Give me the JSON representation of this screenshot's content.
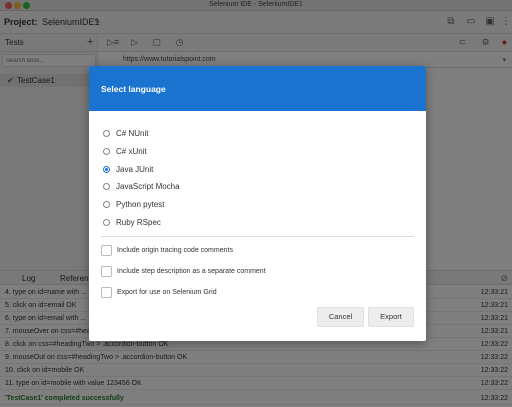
{
  "window": {
    "title": "Selenium IDE - SeleniumIDE1"
  },
  "project": {
    "label": "Project:",
    "name": "SeleniumIDE1"
  },
  "sidebar": {
    "header": "Tests",
    "search_placeholder": "Search tests...",
    "test_cases": [
      {
        "name": "TestCase1"
      }
    ]
  },
  "editor": {
    "url": "https://www.tutorialspoint.com"
  },
  "log": {
    "tabs": [
      "Log",
      "Reference"
    ],
    "lines": [
      {
        "text": "4.  type on id=name with ...",
        "time": "12:33:21"
      },
      {
        "text": "5.  click on id=email OK",
        "time": "12:33:21"
      },
      {
        "text": "6.  type on id=email with ...",
        "time": "12:33:21"
      },
      {
        "text": "7.  mouseOver on css=#heading...",
        "time": "12:33:21"
      },
      {
        "text": "8.  click on css=#headingTwo > .accordion-button OK",
        "time": "12:33:22"
      },
      {
        "text": "9.  mouseOut on css=#headingTwo > .accordion-button OK",
        "time": "12:33:22"
      },
      {
        "text": "10. click on id=mobile OK",
        "time": "12:33:22"
      },
      {
        "text": "11. type on id=mobile with value 123456 OK",
        "time": "12:33:22"
      }
    ],
    "success": {
      "text": "'TestCase1' completed successfully",
      "time": "12:33:22"
    }
  },
  "dialog": {
    "title": "Select language",
    "languages": [
      {
        "label": "C# NUnit",
        "selected": false
      },
      {
        "label": "C# xUnit",
        "selected": false
      },
      {
        "label": "Java JUnit",
        "selected": true
      },
      {
        "label": "JavaScript Mocha",
        "selected": false
      },
      {
        "label": "Python pytest",
        "selected": false
      },
      {
        "label": "Ruby RSpec",
        "selected": false
      }
    ],
    "options": [
      {
        "label": "Include origin tracing code comments",
        "checked": false
      },
      {
        "label": "Include step description as a separate comment",
        "checked": false
      },
      {
        "label": "Export for use on Selenium Grid",
        "checked": false
      }
    ],
    "cancel_label": "Cancel",
    "export_label": "Export"
  },
  "colors": {
    "accent": "#1a73cf",
    "success": "#2a7d2a"
  },
  "icons": [
    "new-window-icon",
    "folder-icon",
    "save-icon",
    "more-icon",
    "run-all-icon",
    "run-icon",
    "stop-icon",
    "speed-icon",
    "record-icon",
    "settings-icon",
    "clear-log-icon"
  ]
}
